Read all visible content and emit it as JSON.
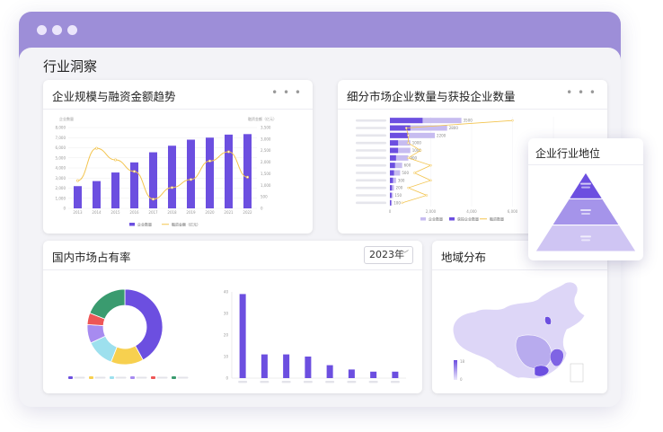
{
  "page": {
    "title": "行业洞察"
  },
  "colors": {
    "accent": "#6c4fe0",
    "titlebar": "#9d8ed8",
    "light": "#c7bcf0",
    "line": "#f3c44e"
  },
  "cards": {
    "scale_trend": {
      "title": "企业规模与融资金额趋势",
      "more_icon": "more-horizontal-icon"
    },
    "segment": {
      "title": "细分市场企业数量与获投企业数量",
      "more_icon": "more-horizontal-icon"
    },
    "share": {
      "title": "国内市场占有率",
      "year_select": "2023年"
    },
    "region": {
      "title": "地域分布"
    },
    "position": {
      "title": "企业行业地位"
    }
  },
  "chart_data": [
    {
      "type": "bar",
      "categories": [
        "2013",
        "2014",
        "2015",
        "2016",
        "2017",
        "2018",
        "2019",
        "2020",
        "2021",
        "2022"
      ],
      "series": [
        {
          "name": "企业数量",
          "type": "bar",
          "values": [
            2200,
            2700,
            3550,
            4550,
            5550,
            6200,
            6800,
            7000,
            7300,
            7350
          ]
        },
        {
          "name": "融资金额（亿元）",
          "type": "line",
          "values": [
            1200,
            2600,
            2100,
            1600,
            400,
            900,
            1250,
            2050,
            2450,
            1350
          ]
        }
      ],
      "ylim_left": [
        0,
        8000
      ],
      "ylim_right": [
        0,
        3500
      ],
      "left_ticks": [
        "0",
        "1,000",
        "2,000",
        "3,000",
        "4,000",
        "5,000",
        "6,000",
        "7,000",
        "8,000"
      ],
      "right_ticks": [
        "0",
        "500",
        "1,000",
        "1,500",
        "2,000",
        "2,500",
        "3,000",
        "3,500"
      ],
      "ylabel_left": "企业数量",
      "ylabel_right": "融资金额（亿元）",
      "legend": "bottom"
    },
    {
      "type": "bar",
      "orientation": "horizontal",
      "series": [
        {
          "name": "企业数量",
          "values": [
            3500,
            2800,
            2200,
            1000,
            1000,
            900,
            600,
            500,
            300,
            200,
            150,
            100
          ]
        },
        {
          "name": "获投企业数量",
          "values": [
            1600,
            1000,
            900,
            400,
            400,
            300,
            250,
            200,
            150,
            100,
            80,
            60
          ]
        },
        {
          "name": "融资数量",
          "type": "line",
          "values": [
            6000,
            800,
            900,
            900,
            1500,
            900,
            2000,
            1200,
            2000,
            900,
            1800,
            600
          ]
        }
      ],
      "data_labels": [
        "3500",
        "2800",
        "2200",
        "1000",
        "1000",
        "900",
        "600",
        "500",
        "300",
        "200",
        "150",
        "100"
      ],
      "xlim": [
        0,
        8000
      ],
      "x_ticks": [
        "0",
        "2,000",
        "4,000",
        "6,000",
        "8,000"
      ],
      "legend": "bottom"
    },
    {
      "type": "pie",
      "slices": [
        {
          "value": 42,
          "color": "#6c4fe0"
        },
        {
          "value": 14,
          "color": "#f7d04f"
        },
        {
          "value": 12,
          "color": "#9de0ee"
        },
        {
          "value": 8,
          "color": "#a78bf0"
        },
        {
          "value": 5,
          "color": "#ee5656"
        },
        {
          "value": 19,
          "color": "#3a9b6f"
        }
      ],
      "legend": "bottom"
    },
    {
      "type": "bar",
      "values": [
        39,
        11,
        11,
        10,
        6,
        4,
        3,
        3
      ],
      "ylim": [
        0,
        40
      ],
      "y_ticks": [
        "0",
        "10",
        "20",
        "30",
        "40"
      ]
    },
    {
      "type": "heatmap",
      "legend": {
        "max": "18",
        "min": "0"
      }
    },
    {
      "type": "pie",
      "shape": "pyramid",
      "levels": [
        {
          "value": 1
        },
        {
          "value": 2
        },
        {
          "value": 3
        }
      ]
    }
  ]
}
